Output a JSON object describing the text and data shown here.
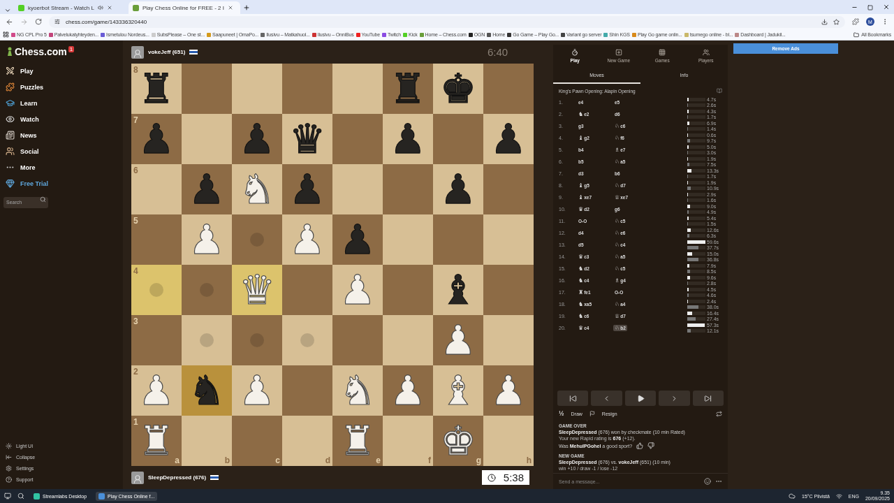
{
  "browser": {
    "tabs": [
      {
        "title": "kyoerbot Stream - Watch L",
        "selected": false
      },
      {
        "title": "Play Chess Online for FREE - 2 I",
        "selected": true
      }
    ],
    "url": "chess.com/game/143336320440",
    "bookmarks": [
      "NG CPL Pro 5",
      "Palvelukatyhteyden...",
      "Ismetulou Nordeus...",
      "SubsPlease – One st...",
      "Saapuneet | OmaPo...",
      "Ilusivu – Matkahuol...",
      "Ilusivu – OnniBus",
      "YouTube",
      "Twitch",
      "Kick",
      "Home – Chess.com",
      "OGN",
      "Home",
      "Go Game – Play Go...",
      "Variant go server",
      "Shin KGS",
      "Play Go game onlin...",
      "tsumego online - bl...",
      "Dashboard | Jadukil..."
    ],
    "all_bookmarks": "All Bookmarks",
    "profile_initial": "M"
  },
  "sidebar": {
    "logo": "Chess.com",
    "badge": "1",
    "items": [
      {
        "label": "Play",
        "kind": "nav"
      },
      {
        "label": "Puzzles",
        "kind": "nav"
      },
      {
        "label": "Learn",
        "kind": "nav"
      },
      {
        "label": "Watch",
        "kind": "nav"
      },
      {
        "label": "News",
        "kind": "nav"
      },
      {
        "label": "Social",
        "kind": "nav"
      },
      {
        "label": "More",
        "kind": "nav"
      },
      {
        "label": "Free Trial",
        "kind": "promo"
      }
    ],
    "search": {
      "placeholder": "Search"
    },
    "footer": [
      "Light UI",
      "Collapse",
      "Settings",
      "Support"
    ]
  },
  "top_player": {
    "name": "vokeJeff (651)",
    "clock": "6:40",
    "clock_active": false
  },
  "bottom_player": {
    "name": "SleepDepressed (676)",
    "clock": "5:38",
    "clock_active": true
  },
  "board": {
    "files": [
      "a",
      "b",
      "c",
      "d",
      "e",
      "f",
      "g",
      "h"
    ],
    "ranks": [
      {
        "label": "8",
        "squares": [
          {
            "piece": "♜",
            "kind": "black",
            "highlighted": false,
            "hint": false
          },
          {
            "highlighted": false,
            "hint": false
          },
          {
            "highlighted": false,
            "hint": false
          },
          {
            "highlighted": false,
            "hint": false
          },
          {
            "highlighted": false,
            "hint": false
          },
          {
            "piece": "♜",
            "kind": "black",
            "highlighted": false,
            "hint": false
          },
          {
            "piece": "♚",
            "kind": "black",
            "highlighted": false,
            "hint": false
          },
          {
            "highlighted": false,
            "hint": false
          }
        ]
      },
      {
        "label": "7",
        "squares": [
          {
            "piece": "♟",
            "kind": "black",
            "highlighted": false,
            "hint": false
          },
          {
            "highlighted": false,
            "hint": false
          },
          {
            "piece": "♟",
            "kind": "black",
            "highlighted": false,
            "hint": false
          },
          {
            "piece": "♛",
            "kind": "black",
            "highlighted": false,
            "hint": false
          },
          {
            "highlighted": false,
            "hint": false
          },
          {
            "piece": "♟",
            "kind": "black",
            "highlighted": false,
            "hint": false
          },
          {
            "highlighted": false,
            "hint": false
          },
          {
            "piece": "♟",
            "kind": "black",
            "highlighted": false,
            "hint": false
          }
        ]
      },
      {
        "label": "6",
        "squares": [
          {
            "highlighted": false,
            "hint": false
          },
          {
            "piece": "♟",
            "kind": "black",
            "highlighted": false,
            "hint": false
          },
          {
            "piece": "♞",
            "kind": "white",
            "highlighted": false,
            "hint": false
          },
          {
            "piece": "♟",
            "kind": "black",
            "highlighted": false,
            "hint": false
          },
          {
            "highlighted": false,
            "hint": false
          },
          {
            "highlighted": false,
            "hint": false
          },
          {
            "piece": "♟",
            "kind": "black",
            "highlighted": false,
            "hint": false
          },
          {
            "highlighted": false,
            "hint": false
          }
        ]
      },
      {
        "label": "5",
        "squares": [
          {
            "highlighted": false,
            "hint": false
          },
          {
            "piece": "♟",
            "kind": "white",
            "highlighted": false,
            "hint": false
          },
          {
            "highlighted": false,
            "hint": true
          },
          {
            "piece": "♟",
            "kind": "white",
            "highlighted": false,
            "hint": false
          },
          {
            "piece": "♟",
            "kind": "black",
            "highlighted": false,
            "hint": false
          },
          {
            "highlighted": false,
            "hint": false
          },
          {
            "highlighted": false,
            "hint": false
          },
          {
            "highlighted": false,
            "hint": false
          }
        ]
      },
      {
        "label": "4",
        "squares": [
          {
            "highlighted": true,
            "hint": true
          },
          {
            "highlighted": false,
            "hint": true
          },
          {
            "piece": "♛",
            "kind": "white",
            "highlighted": true,
            "hint": false
          },
          {
            "highlighted": false,
            "hint": false
          },
          {
            "piece": "♟",
            "kind": "white",
            "highlighted": false,
            "hint": false
          },
          {
            "highlighted": false,
            "hint": false
          },
          {
            "piece": "♝",
            "kind": "black",
            "highlighted": false,
            "hint": false
          },
          {
            "highlighted": false,
            "hint": false
          }
        ]
      },
      {
        "label": "3",
        "squares": [
          {
            "highlighted": false,
            "hint": false
          },
          {
            "highlighted": false,
            "hint": true
          },
          {
            "highlighted": false,
            "hint": true
          },
          {
            "highlighted": false,
            "hint": true
          },
          {
            "highlighted": false,
            "hint": false
          },
          {
            "highlighted": false,
            "hint": false
          },
          {
            "piece": "♟",
            "kind": "white",
            "highlighted": false,
            "hint": false
          },
          {
            "highlighted": false,
            "hint": false
          }
        ]
      },
      {
        "label": "2",
        "squares": [
          {
            "piece": "♟",
            "kind": "white",
            "highlighted": false,
            "hint": false
          },
          {
            "piece": "♞",
            "kind": "black",
            "highlighted": true,
            "hint": false
          },
          {
            "piece": "♟",
            "kind": "white",
            "highlighted": false,
            "hint": false
          },
          {
            "highlighted": false,
            "hint": false
          },
          {
            "piece": "♞",
            "kind": "white",
            "highlighted": false,
            "hint": false
          },
          {
            "piece": "♟",
            "kind": "white",
            "highlighted": false,
            "hint": false
          },
          {
            "piece": "♝",
            "kind": "white",
            "highlighted": false,
            "hint": false
          },
          {
            "piece": "♟",
            "kind": "white",
            "highlighted": false,
            "hint": false
          }
        ]
      },
      {
        "label": "1",
        "squares": [
          {
            "piece": "♜",
            "kind": "white",
            "highlighted": false,
            "hint": false
          },
          {
            "highlighted": false,
            "hint": false
          },
          {
            "highlighted": false,
            "hint": false
          },
          {
            "highlighted": false,
            "hint": false
          },
          {
            "piece": "♜",
            "kind": "white",
            "highlighted": false,
            "hint": false
          },
          {
            "highlighted": false,
            "hint": false
          },
          {
            "piece": "♚",
            "kind": "white",
            "highlighted": false,
            "hint": false
          },
          {
            "highlighted": false,
            "hint": false
          }
        ]
      }
    ]
  },
  "panel": {
    "tabs": [
      {
        "label": "Play",
        "selected": true
      },
      {
        "label": "New Game",
        "selected": false
      },
      {
        "label": "Games",
        "selected": false
      },
      {
        "label": "Players",
        "selected": false
      }
    ],
    "subtabs": [
      {
        "label": "Moves",
        "selected": true
      },
      {
        "label": "Info",
        "selected": false
      }
    ],
    "opening": "King's Pawn Opening: Alapin Opening",
    "moves": [
      {
        "number": "1.",
        "white": {
          "san": "e4",
          "selected": false
        },
        "black": {
          "san": "e5",
          "selected": false
        },
        "white_time": {
          "reading": "4.7s",
          "level": 0.08
        },
        "black_time": {
          "reading": "2.6s",
          "level": 0.04
        }
      },
      {
        "number": "2.",
        "white": {
          "piece": "♞",
          "san": "e2",
          "selected": false
        },
        "black": {
          "san": "d6",
          "selected": false
        },
        "white_time": {
          "reading": "4.3s",
          "level": 0.07
        },
        "black_time": {
          "reading": "1.7s",
          "level": 0.03
        }
      },
      {
        "number": "3.",
        "white": {
          "san": "g3",
          "selected": false
        },
        "black": {
          "piece": "♘",
          "san": "c6",
          "selected": false
        },
        "white_time": {
          "reading": "6.9s",
          "level": 0.11
        },
        "black_time": {
          "reading": "1.4s",
          "level": 0.02
        }
      },
      {
        "number": "4.",
        "white": {
          "piece": "♝",
          "san": "g2",
          "selected": false
        },
        "black": {
          "piece": "♘",
          "san": "f6",
          "selected": false
        },
        "white_time": {
          "reading": "0.6s",
          "level": 0.02
        },
        "black_time": {
          "reading": "9.7s",
          "level": 0.16
        }
      },
      {
        "number": "5.",
        "white": {
          "san": "b4",
          "selected": false
        },
        "black": {
          "piece": "♗",
          "san": "e7",
          "selected": false
        },
        "white_time": {
          "reading": "5.0s",
          "level": 0.08
        },
        "black_time": {
          "reading": "3.0s",
          "level": 0.05
        }
      },
      {
        "number": "6.",
        "white": {
          "san": "b5",
          "selected": false
        },
        "black": {
          "piece": "♘",
          "san": "a5",
          "selected": false
        },
        "white_time": {
          "reading": "1.9s",
          "level": 0.03
        },
        "black_time": {
          "reading": "7.5s",
          "level": 0.12
        }
      },
      {
        "number": "7.",
        "white": {
          "san": "d3",
          "selected": false
        },
        "black": {
          "san": "b6",
          "selected": false
        },
        "white_time": {
          "reading": "13.3s",
          "level": 0.22
        },
        "black_time": {
          "reading": "1.7s",
          "level": 0.03
        }
      },
      {
        "number": "8.",
        "white": {
          "piece": "♝",
          "san": "g5",
          "selected": false
        },
        "black": {
          "piece": "♘",
          "san": "d7",
          "selected": false
        },
        "white_time": {
          "reading": "1.9s",
          "level": 0.03
        },
        "black_time": {
          "reading": "10.9s",
          "level": 0.18
        }
      },
      {
        "number": "9.",
        "white": {
          "piece": "♝",
          "san": "xe7",
          "selected": false
        },
        "black": {
          "piece": "♕",
          "san": "xe7",
          "selected": false
        },
        "white_time": {
          "reading": "2.9s",
          "level": 0.05
        },
        "black_time": {
          "reading": "1.6s",
          "level": 0.03
        }
      },
      {
        "number": "10.",
        "white": {
          "piece": "♛",
          "san": "d2",
          "selected": false
        },
        "black": {
          "san": "g6",
          "selected": false
        },
        "white_time": {
          "reading": "9.0s",
          "level": 0.15
        },
        "black_time": {
          "reading": "4.9s",
          "level": 0.08
        }
      },
      {
        "number": "11.",
        "white": {
          "san": "O-O",
          "selected": false
        },
        "black": {
          "piece": "♘",
          "san": "c5",
          "selected": false
        },
        "white_time": {
          "reading": "5.4s",
          "level": 0.09
        },
        "black_time": {
          "reading": "1.5s",
          "level": 0.03
        }
      },
      {
        "number": "12.",
        "white": {
          "san": "d4",
          "selected": false
        },
        "black": {
          "piece": "♘",
          "san": "e6",
          "selected": false
        },
        "white_time": {
          "reading": "12.6s",
          "level": 0.21
        },
        "black_time": {
          "reading": "6.3s",
          "level": 0.1
        }
      },
      {
        "number": "13.",
        "white": {
          "san": "d5",
          "selected": false
        },
        "black": {
          "piece": "♘",
          "san": "c4",
          "selected": false
        },
        "white_time": {
          "reading": "59.6s",
          "level": 0.99
        },
        "black_time": {
          "reading": "37.7s",
          "level": 0.63
        }
      },
      {
        "number": "14.",
        "white": {
          "piece": "♛",
          "san": "c3",
          "selected": false
        },
        "black": {
          "piece": "♘",
          "san": "a5",
          "selected": false
        },
        "white_time": {
          "reading": "15.0s",
          "level": 0.25
        },
        "black_time": {
          "reading": "36.8s",
          "level": 0.61
        }
      },
      {
        "number": "15.",
        "white": {
          "piece": "♞",
          "san": "d2",
          "selected": false
        },
        "black": {
          "piece": "♘",
          "san": "c5",
          "selected": false
        },
        "white_time": {
          "reading": "7.9s",
          "level": 0.13
        },
        "black_time": {
          "reading": "8.5s",
          "level": 0.14
        }
      },
      {
        "number": "16.",
        "white": {
          "piece": "♞",
          "san": "c4",
          "selected": false
        },
        "black": {
          "piece": "♗",
          "san": "g4",
          "selected": false
        },
        "white_time": {
          "reading": "9.6s",
          "level": 0.16
        },
        "black_time": {
          "reading": "2.8s",
          "level": 0.05
        }
      },
      {
        "number": "17.",
        "white": {
          "piece": "♜",
          "san": "fe1",
          "selected": false
        },
        "black": {
          "san": "O-O",
          "selected": false
        },
        "white_time": {
          "reading": "4.5s",
          "level": 0.08
        },
        "black_time": {
          "reading": "4.6s",
          "level": 0.08
        }
      },
      {
        "number": "18.",
        "white": {
          "piece": "♞",
          "san": "xa5",
          "selected": false
        },
        "black": {
          "piece": "♘",
          "san": "a4",
          "selected": false
        },
        "white_time": {
          "reading": "2.4s",
          "level": 0.04
        },
        "black_time": {
          "reading": "38.0s",
          "level": 0.63
        }
      },
      {
        "number": "19.",
        "white": {
          "piece": "♞",
          "san": "c6",
          "selected": false
        },
        "black": {
          "piece": "♕",
          "san": "d7",
          "selected": false
        },
        "white_time": {
          "reading": "16.4s",
          "level": 0.27
        },
        "black_time": {
          "reading": "27.4s",
          "level": 0.46
        }
      },
      {
        "number": "20.",
        "white": {
          "piece": "♛",
          "san": "c4",
          "selected": false
        },
        "black": {
          "piece": "♘",
          "san": "b2",
          "selected": true
        },
        "white_time": {
          "reading": "57.3s",
          "level": 0.96
        },
        "black_time": {
          "reading": "12.1s",
          "level": 0.2
        }
      }
    ],
    "draw": {
      "symbol": "½",
      "label": "Draw"
    },
    "resign": "Resign",
    "messages": [
      {
        "kind": "heading",
        "text": "GAME OVER"
      },
      {
        "kind": "line",
        "text": "**SleepDepressed** (676) won by checkmate (10 min Rated)"
      },
      {
        "kind": "note",
        "text": "Your new Rapid rating is **676** (+12)."
      },
      {
        "kind": "sport",
        "text": "Was **MehulPGohel** a good sport?"
      },
      {
        "kind": "heading",
        "text": "NEW GAME"
      },
      {
        "kind": "line",
        "text": "**SleepDepressed** (676) vs. **vokeJeff** (651) (10 min)"
      },
      {
        "kind": "note",
        "text": "win +10 / draw -1 / lose -12"
      }
    ],
    "chat": {
      "placeholder": "Send a message..."
    }
  },
  "ads": {
    "label": "Remove Ads"
  },
  "taskbar": {
    "apps": [
      {
        "label": "Streamlabs Desktop",
        "selected": false
      },
      {
        "label": "Play Chess Online f...",
        "selected": true
      }
    ],
    "weather": "15°C Pilvistä",
    "language": "ENG",
    "time": "9.35",
    "date": "20/09/2025"
  }
}
